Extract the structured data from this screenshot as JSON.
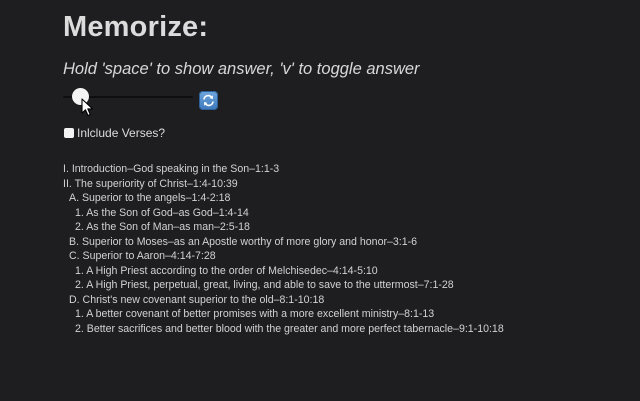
{
  "title": "Memorize:",
  "subtitle": "Hold 'space' to show answer, 'v' to toggle answer",
  "slider": {
    "value": 0.14
  },
  "toggle_button": {
    "icon": "repeat-icon",
    "color": "#4a8ad0"
  },
  "include_verses": {
    "label": "Inlclude Verses?",
    "checked": false
  },
  "outline": [
    {
      "level": 0,
      "text": "I. Introduction–God speaking in the Son–1:1-3"
    },
    {
      "level": 0,
      "text": "II. The superiority of Christ–1:4-10:39"
    },
    {
      "level": 1,
      "text": "A. Superior to the angels–1:4-2:18"
    },
    {
      "level": 2,
      "text": "1. As the Son of God–as God–1:4-14"
    },
    {
      "level": 2,
      "text": "2. As the Son of Man–as man–2:5-18"
    },
    {
      "level": 1,
      "text": "B. Superior to Moses–as an Apostle worthy of more glory and honor–3:1-6"
    },
    {
      "level": 1,
      "text": "C. Superior to Aaron–4:14-7:28"
    },
    {
      "level": 2,
      "text": "1. A High Priest according to the order of Melchisedec–4:14-5:10"
    },
    {
      "level": 2,
      "text": "2. A High Priest, perpetual, great, living, and able to save to the uttermost–7:1-28"
    },
    {
      "level": 1,
      "text": "D. Christ's new covenant superior to the old–8:1-10:18"
    },
    {
      "level": 2,
      "text": "1. A better covenant of better promises with a more excellent ministry–8:1-13"
    },
    {
      "level": 2,
      "text": "2. Better sacrifices and better blood with the greater and more perfect tabernacle–9:1-10:18"
    }
  ]
}
